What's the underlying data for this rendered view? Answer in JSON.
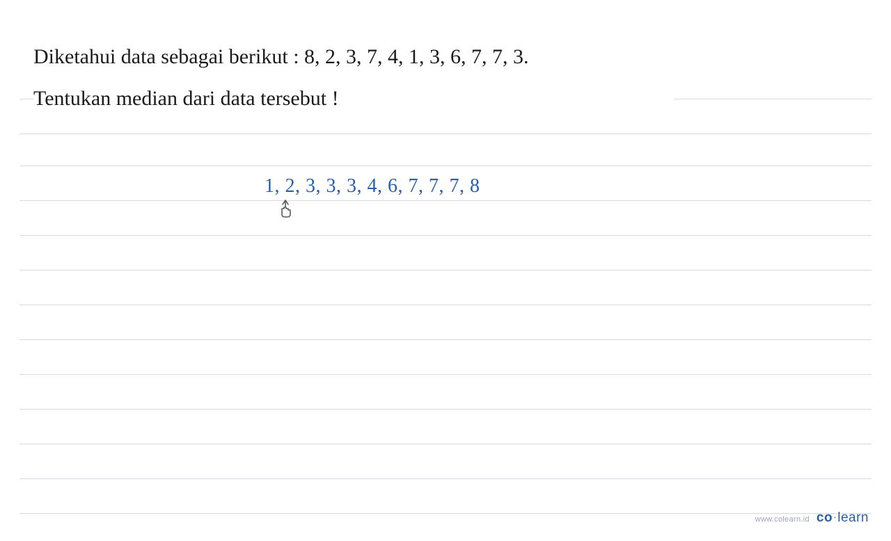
{
  "question": {
    "line1": "Diketahui data sebagai berikut : 8, 2, 3, 7, 4, 1, 3, 6, 7, 7, 3.",
    "line2": "Tentukan median dari data tersebut !"
  },
  "handwritten": {
    "sorted_data": "1, 2, 3, 3, 3, 4, 6, 7, 7, 7, 8"
  },
  "watermark": {
    "url": "www.colearn.id",
    "brand_part1": "co",
    "brand_dot": "·",
    "brand_part2": "learn"
  },
  "layout": {
    "ruled_line_positions": [
      84,
      134,
      180,
      230,
      280,
      330,
      380,
      430,
      480,
      530,
      580,
      630,
      680
    ]
  }
}
